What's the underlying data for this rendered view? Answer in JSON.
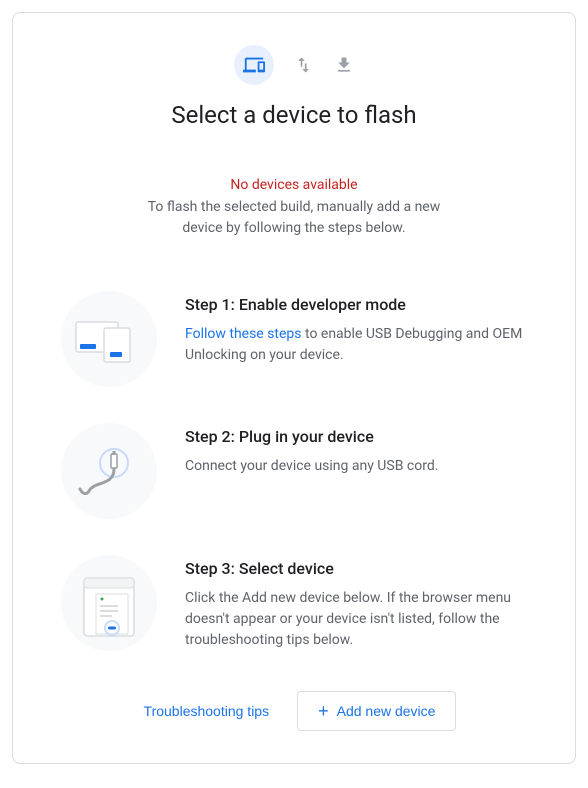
{
  "tabs": {
    "devices": "devices-icon",
    "transfer": "transfer-icon",
    "download": "download-icon"
  },
  "title": "Select a device to flash",
  "alert": {
    "heading": "No devices available",
    "description": "To flash the selected build, manually add a new device by following the steps below."
  },
  "steps": [
    {
      "title": "Step 1: Enable developer mode",
      "link_text": "Follow these steps",
      "desc_suffix": " to enable USB Debugging and OEM Unlocking on your device."
    },
    {
      "title": "Step 2: Plug in your device",
      "desc": "Connect your device using any USB cord."
    },
    {
      "title": "Step 3: Select device",
      "desc": "Click the Add new device below. If the browser menu doesn't appear or your device isn't listed, follow the troubleshooting tips below."
    }
  ],
  "actions": {
    "troubleshoot": "Troubleshooting tips",
    "add_device": "Add new device"
  }
}
